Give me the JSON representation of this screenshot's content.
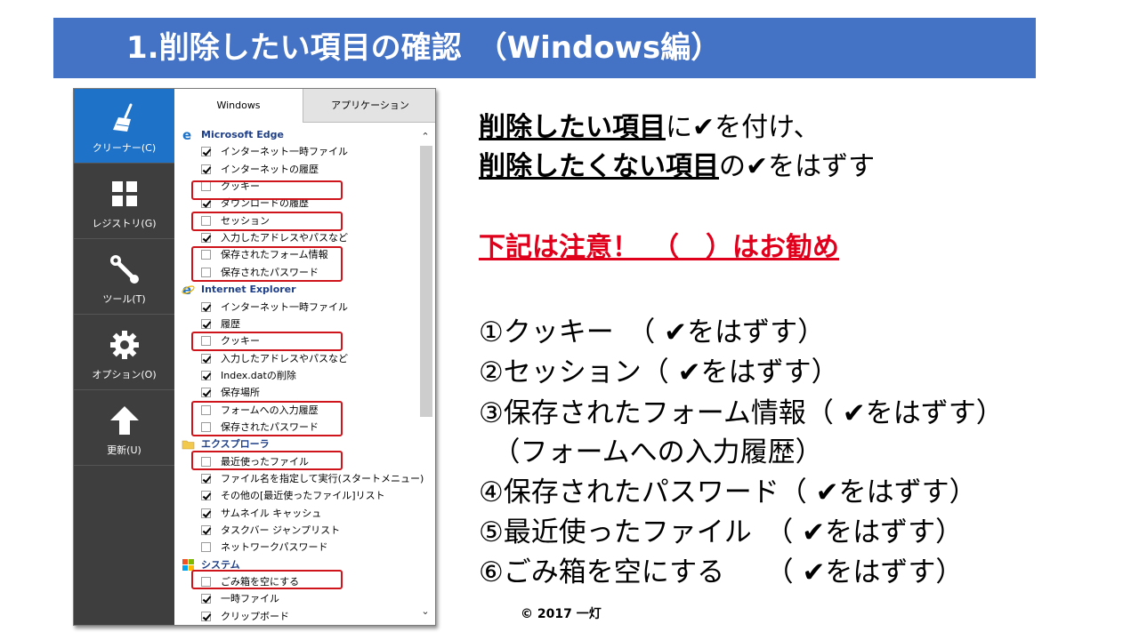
{
  "title": "1.削除したい項目の確認　（Windows編）",
  "app": {
    "nav": [
      {
        "label": "クリーナー(C)",
        "icon": "broom-icon"
      },
      {
        "label": "レジストリ(G)",
        "icon": "grid-icon"
      },
      {
        "label": "ツール(T)",
        "icon": "wrench-icon"
      },
      {
        "label": "オプション(O)",
        "icon": "gear-icon"
      },
      {
        "label": "更新(U)",
        "icon": "up-arrow-icon"
      }
    ],
    "tabs": [
      "Windows",
      "アプリケーション"
    ],
    "sections": [
      {
        "title": "Microsoft Edge",
        "icon": "edge-icon",
        "items": [
          {
            "label": "インターネット一時ファイル",
            "checked": true
          },
          {
            "label": "インターネットの履歴",
            "checked": true
          },
          {
            "label": "クッキー",
            "checked": false
          },
          {
            "label": "ダウンロードの履歴",
            "checked": true
          },
          {
            "label": "セッション",
            "checked": false
          },
          {
            "label": "入力したアドレスやパスなど",
            "checked": true
          },
          {
            "label": "保存されたフォーム情報",
            "checked": false
          },
          {
            "label": "保存されたパスワード",
            "checked": false
          }
        ]
      },
      {
        "title": "Internet Explorer",
        "icon": "ie-icon",
        "items": [
          {
            "label": "インターネット一時ファイル",
            "checked": true
          },
          {
            "label": "履歴",
            "checked": true
          },
          {
            "label": "クッキー",
            "checked": false
          },
          {
            "label": "入力したアドレスやパスなど",
            "checked": true
          },
          {
            "label": "Index.datの削除",
            "checked": true
          },
          {
            "label": "保存場所",
            "checked": true
          },
          {
            "label": "フォームへの入力履歴",
            "checked": false
          },
          {
            "label": "保存されたパスワード",
            "checked": false
          }
        ]
      },
      {
        "title": "エクスプローラ",
        "icon": "folder-icon",
        "items": [
          {
            "label": "最近使ったファイル",
            "checked": false
          },
          {
            "label": "ファイル名を指定して実行(スタートメニュー)",
            "checked": true
          },
          {
            "label": "その他の[最近使ったファイル]リスト",
            "checked": true
          },
          {
            "label": "サムネイル キャッシュ",
            "checked": true
          },
          {
            "label": "タスクバー ジャンプリスト",
            "checked": true
          },
          {
            "label": "ネットワークパスワード",
            "checked": false
          }
        ]
      },
      {
        "title": "システム",
        "icon": "windows-icon",
        "items": [
          {
            "label": "ごみ箱を空にする",
            "checked": false
          },
          {
            "label": "一時ファイル",
            "checked": true
          },
          {
            "label": "クリップボード",
            "checked": true
          }
        ]
      }
    ]
  },
  "instructions": {
    "line1_bold": "削除したい項目",
    "line1_rest": "に✔を付け、",
    "line2_bold": "削除したくない項目",
    "line2_rest": "の✔をはずす",
    "warning": "下記は注意！　（　）はお勧め",
    "items": [
      "①クッキー　（ ✔をはずす）",
      "②セッション（ ✔をはずす）",
      "③保存されたフォーム情報（ ✔をはずす）",
      "　（フォームへの入力履歴）",
      "④保存されたパスワード（ ✔をはずす）",
      "⑤最近使ったファイル　（ ✔をはずす）",
      "⑥ごみ箱を空にする　　（ ✔をはずす）"
    ],
    "copyright": "© 2017 一灯"
  }
}
